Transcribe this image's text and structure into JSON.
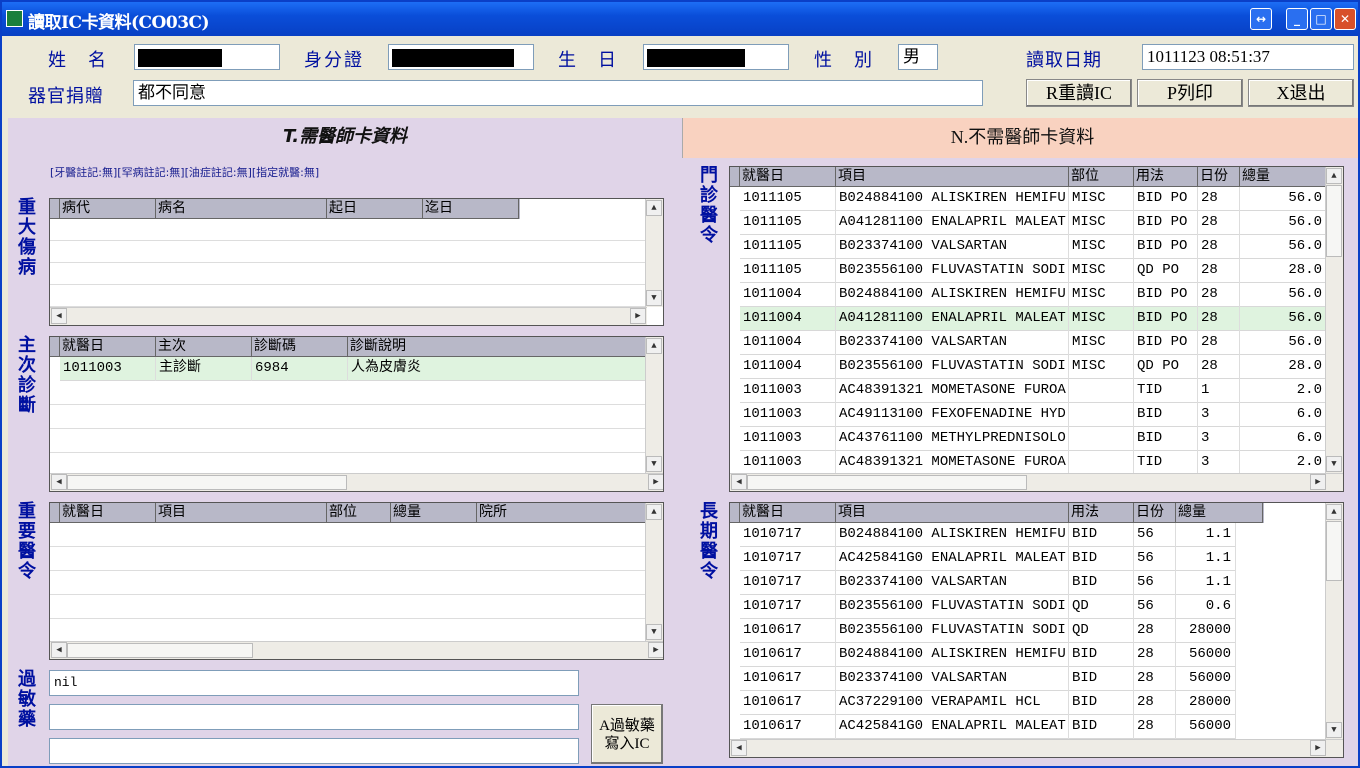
{
  "window": {
    "title": "讀取IC卡資料(CO03C)"
  },
  "header": {
    "name_label": "姓　名",
    "id_label": "身分證",
    "birth_label": "生　日",
    "gender_label": "性　別",
    "gender_value": "男",
    "read_date_label": "讀取日期",
    "read_date_value": "1011123 08:51:37",
    "organ_label": "器官捐贈",
    "organ_value": "都不同意"
  },
  "buttons": {
    "reread": "R重讀IC",
    "print": "P列印",
    "exit": "X退出",
    "allergy_write_1": "A過敏藥",
    "allergy_write_2": "寫入IC"
  },
  "tabs": {
    "left": "T.需醫師卡資料",
    "right": "N.不需醫師卡資料"
  },
  "note": "[牙醫註記:無][罕病註記:無][油症註記:無][指定就醫:無]",
  "sections": {
    "major": "重大傷病",
    "diag": "主次診斷",
    "important": "重要醫令",
    "allergy": "過敏藥",
    "outpatient": "門診醫令",
    "longterm": "長期醫令"
  },
  "major_grid": {
    "headers": [
      "病代",
      "病名",
      "起日",
      "迄日"
    ]
  },
  "diag_grid": {
    "headers": [
      "就醫日",
      "主次",
      "診斷碼",
      "診斷說明"
    ],
    "rows": [
      [
        "1011003",
        "主診斷",
        "6984",
        "人為皮膚炎"
      ]
    ]
  },
  "important_grid": {
    "headers": [
      "就醫日",
      "項目",
      "部位",
      "總量",
      "院所"
    ]
  },
  "allergy": {
    "line1": "nil",
    "line2": "",
    "line3": ""
  },
  "outpatient_grid": {
    "headers": [
      "就醫日",
      "項目",
      "部位",
      "用法",
      "日份",
      "總量"
    ],
    "rows": [
      [
        "1011105",
        "B024884100 ALISKIREN HEMIFU",
        "MISC",
        "BID PO",
        "28",
        "56.0"
      ],
      [
        "1011105",
        "A041281100 ENALAPRIL MALEAT",
        "MISC",
        "BID PO",
        "28",
        "56.0"
      ],
      [
        "1011105",
        "B023374100 VALSARTAN",
        "MISC",
        "BID PO",
        "28",
        "56.0"
      ],
      [
        "1011105",
        "B023556100 FLUVASTATIN SODI",
        "MISC",
        "QD PO",
        "28",
        "28.0"
      ],
      [
        "1011004",
        "B024884100 ALISKIREN HEMIFU",
        "MISC",
        "BID PO",
        "28",
        "56.0"
      ],
      [
        "1011004",
        "A041281100 ENALAPRIL MALEAT",
        "MISC",
        "BID PO",
        "28",
        "56.0"
      ],
      [
        "1011004",
        "B023374100 VALSARTAN",
        "MISC",
        "BID PO",
        "28",
        "56.0"
      ],
      [
        "1011004",
        "B023556100 FLUVASTATIN SODI",
        "MISC",
        "QD PO",
        "28",
        "28.0"
      ],
      [
        "1011003",
        "AC48391321 MOMETASONE FUROA",
        "",
        "TID",
        "1",
        "2.0"
      ],
      [
        "1011003",
        "AC49113100 FEXOFENADINE HYD",
        "",
        "BID",
        "3",
        "6.0"
      ],
      [
        "1011003",
        "AC43761100 METHYLPREDNISOLO",
        "",
        "BID",
        "3",
        "6.0"
      ],
      [
        "1011003",
        "AC48391321 MOMETASONE FUROA",
        "",
        "TID",
        "3",
        "2.0"
      ]
    ]
  },
  "longterm_grid": {
    "headers": [
      "就醫日",
      "項目",
      "用法",
      "日份",
      "總量"
    ],
    "rows": [
      [
        "1010717",
        "B024884100 ALISKIREN HEMIFU",
        "BID",
        "56",
        "1.1"
      ],
      [
        "1010717",
        "AC425841G0 ENALAPRIL MALEAT",
        "BID",
        "56",
        "1.1"
      ],
      [
        "1010717",
        "B023374100 VALSARTAN",
        "BID",
        "56",
        "1.1"
      ],
      [
        "1010717",
        "B023556100 FLUVASTATIN SODI",
        "QD",
        "56",
        "0.6"
      ],
      [
        "1010617",
        "B023556100 FLUVASTATIN SODI",
        "QD",
        "28",
        "28000"
      ],
      [
        "1010617",
        "B024884100 ALISKIREN HEMIFU",
        "BID",
        "28",
        "56000"
      ],
      [
        "1010617",
        "B023374100 VALSARTAN",
        "BID",
        "28",
        "56000"
      ],
      [
        "1010617",
        "AC37229100 VERAPAMIL HCL",
        "BID",
        "28",
        "28000"
      ],
      [
        "1010617",
        "AC425841G0 ENALAPRIL MALEAT",
        "BID",
        "28",
        "56000"
      ]
    ]
  }
}
